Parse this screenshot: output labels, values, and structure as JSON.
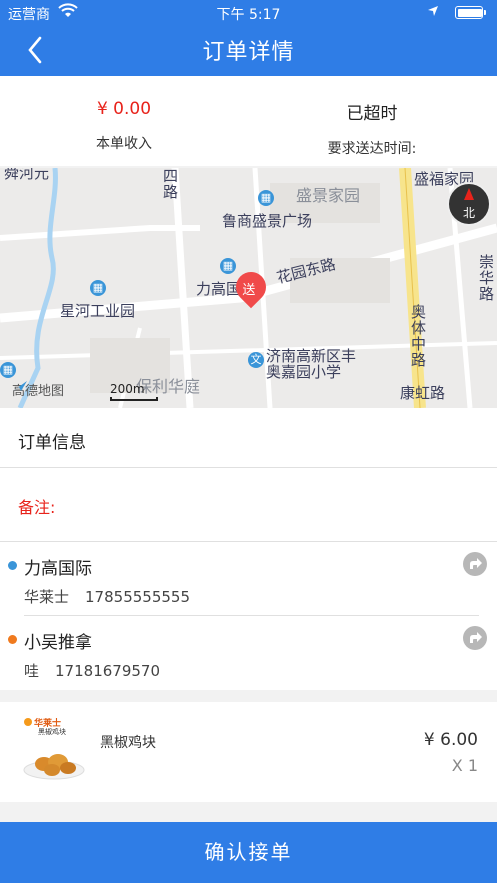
{
  "status_bar": {
    "carrier": "运营商",
    "time": "下午 5:17",
    "battery_level": 0.95
  },
  "nav": {
    "title": "订单详情",
    "back_icon": "chevron-left-icon"
  },
  "summary": {
    "income_value": "¥ 0.00",
    "income_label": "本单收入",
    "status_value": "已超时",
    "deadline_label": "要求送达时间:"
  },
  "map": {
    "labels": {
      "shengjing": "盛景家园",
      "shengfu": "盛福家园",
      "lushang": "鲁商盛景广场",
      "ligao": "力高国际",
      "huayuan": "花园东路",
      "xinghe": "星河工业园",
      "jinan": "济南高新区丰",
      "aojia": "奥嘉园小学",
      "baoli": "保利华庭",
      "aoti": "奥体中路",
      "kanghong": "康虹路",
      "chonghua": "崇华路",
      "si_road": "四路",
      "top_left": "舜河元"
    },
    "pin_label": "送",
    "compass_label": "北",
    "logo": "高德地图",
    "scale": "200m",
    "colors": {
      "land": "#ecebea",
      "road": "#ffffff",
      "river": "#a9d3f2",
      "main_road": "#f7e48c"
    }
  },
  "order_info": {
    "title": "订单信息",
    "remark_label": "备注:"
  },
  "pickup": {
    "name": "力高国际",
    "contact_name": "华莱士",
    "phone": "17855555555",
    "dot_color": "#3a95d8"
  },
  "dropoff": {
    "name": "小吴推拿",
    "contact_name": "哇",
    "phone": "17181679570",
    "dot_color": "#f07a1e"
  },
  "goods": {
    "brand": "华莱士",
    "item": "黑椒鸡块",
    "thumb_caption": "黑椒鸡块",
    "price": "¥ 6.00",
    "quantity": "X 1"
  },
  "confirm_label": "确认接单"
}
